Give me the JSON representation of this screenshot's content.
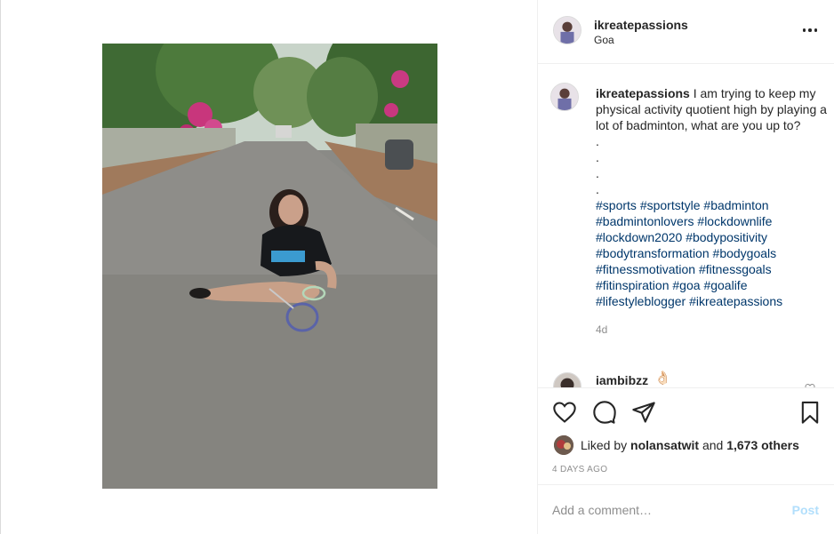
{
  "header": {
    "username": "ikreatepassions",
    "location": "Goa"
  },
  "caption": {
    "username": "ikreatepassions",
    "text": "I am trying to keep my physical activity quotient high by playing a lot of badminton, what are you up to?",
    "dots": [
      ".",
      ".",
      ".",
      "."
    ],
    "hashtags": [
      "#sports",
      "#sportstyle",
      "#badminton",
      "#badmintonlovers",
      "#lockdownlife",
      "#lockdown2020",
      "#bodypositivity",
      "#bodytransformation",
      "#bodygoals",
      "#fitnessmotivation",
      "#fitnessgoals",
      "#fitinspiration",
      "#goa",
      "#goalife",
      "#lifestyleblogger",
      "#ikreatepassions"
    ],
    "time_ago": "4d"
  },
  "comment": {
    "username": "iambibzz",
    "emoji": "👌🏻"
  },
  "likes": {
    "prefix": "Liked by ",
    "user": "nolansatwit",
    "middle": " and ",
    "count": "1,673 others"
  },
  "post_date": "4 DAYS AGO",
  "add_comment": {
    "placeholder": "Add a comment…",
    "post_label": "Post"
  },
  "icons": {
    "like": "heart-icon",
    "comment": "comment-bubble-icon",
    "share": "paper-plane-icon",
    "save": "bookmark-icon",
    "more": "more-options-icon"
  },
  "colors": {
    "hashtag": "#00376b",
    "muted": "#8e8e8e",
    "post_disabled": "#b2dffc",
    "text": "#262626"
  }
}
